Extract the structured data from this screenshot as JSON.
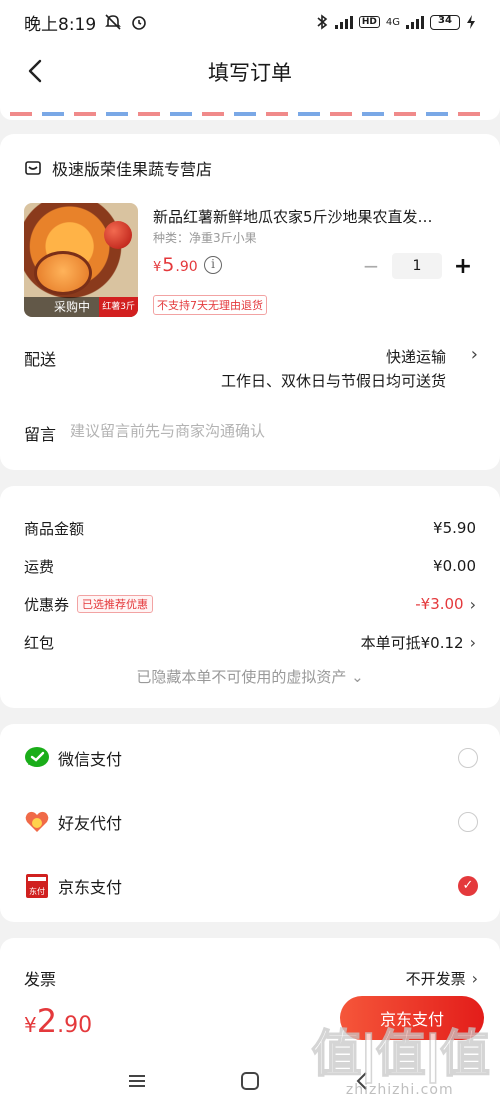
{
  "status_bar": {
    "time": "晚上8:19",
    "network": "4G",
    "battery": "34"
  },
  "nav": {
    "title": "填写订单"
  },
  "shop": {
    "name": "极速版荣佳果蔬专营店",
    "product": {
      "name": "新品红薯新鲜地瓜农家5斤沙地果农直发…",
      "spec": "种类：净重3斤小果",
      "price_symbol": "¥",
      "price_int": "5",
      "price_dec": ".90",
      "quantity": "1",
      "img_tag": "采购中",
      "img_price_tag": "红薯3斤",
      "return_policy": "不支持7天无理由退货"
    },
    "delivery": {
      "label": "配送",
      "method": "快递运输",
      "note": "工作日、双休日与节假日均可送货"
    },
    "remark": {
      "label": "留言",
      "placeholder": "建议留言前先与商家沟通确认"
    }
  },
  "amounts": {
    "goods": {
      "label": "商品金额",
      "value": "¥5.90"
    },
    "shipping": {
      "label": "运费",
      "value": "¥0.00"
    },
    "coupon": {
      "label": "优惠券",
      "badge": "已选推荐优惠",
      "value": "-¥3.00"
    },
    "red_packet": {
      "label": "红包",
      "value": "本单可抵¥0.12"
    },
    "hidden_assets": "已隐藏本单不可使用的虚拟资产 ⌄"
  },
  "payment": {
    "options": [
      {
        "label": "微信支付",
        "icon": "wechat-pay-icon",
        "selected": false
      },
      {
        "label": "好友代付",
        "icon": "friend-pay-icon",
        "selected": false
      },
      {
        "label": "京东支付",
        "icon": "jd-pay-icon",
        "selected": true
      }
    ],
    "jd_logo_text": "东付"
  },
  "invoice": {
    "label": "发票",
    "value": "不开发票"
  },
  "bottom": {
    "total_symbol": "¥",
    "total_int": "2",
    "total_dec": ".90",
    "pay_button": "京东支付"
  },
  "watermark": {
    "big": "值|值|值",
    "small": "zhizhizhi.com"
  },
  "colors": {
    "accent": "#e4393c",
    "wechat": "#1aad19"
  }
}
